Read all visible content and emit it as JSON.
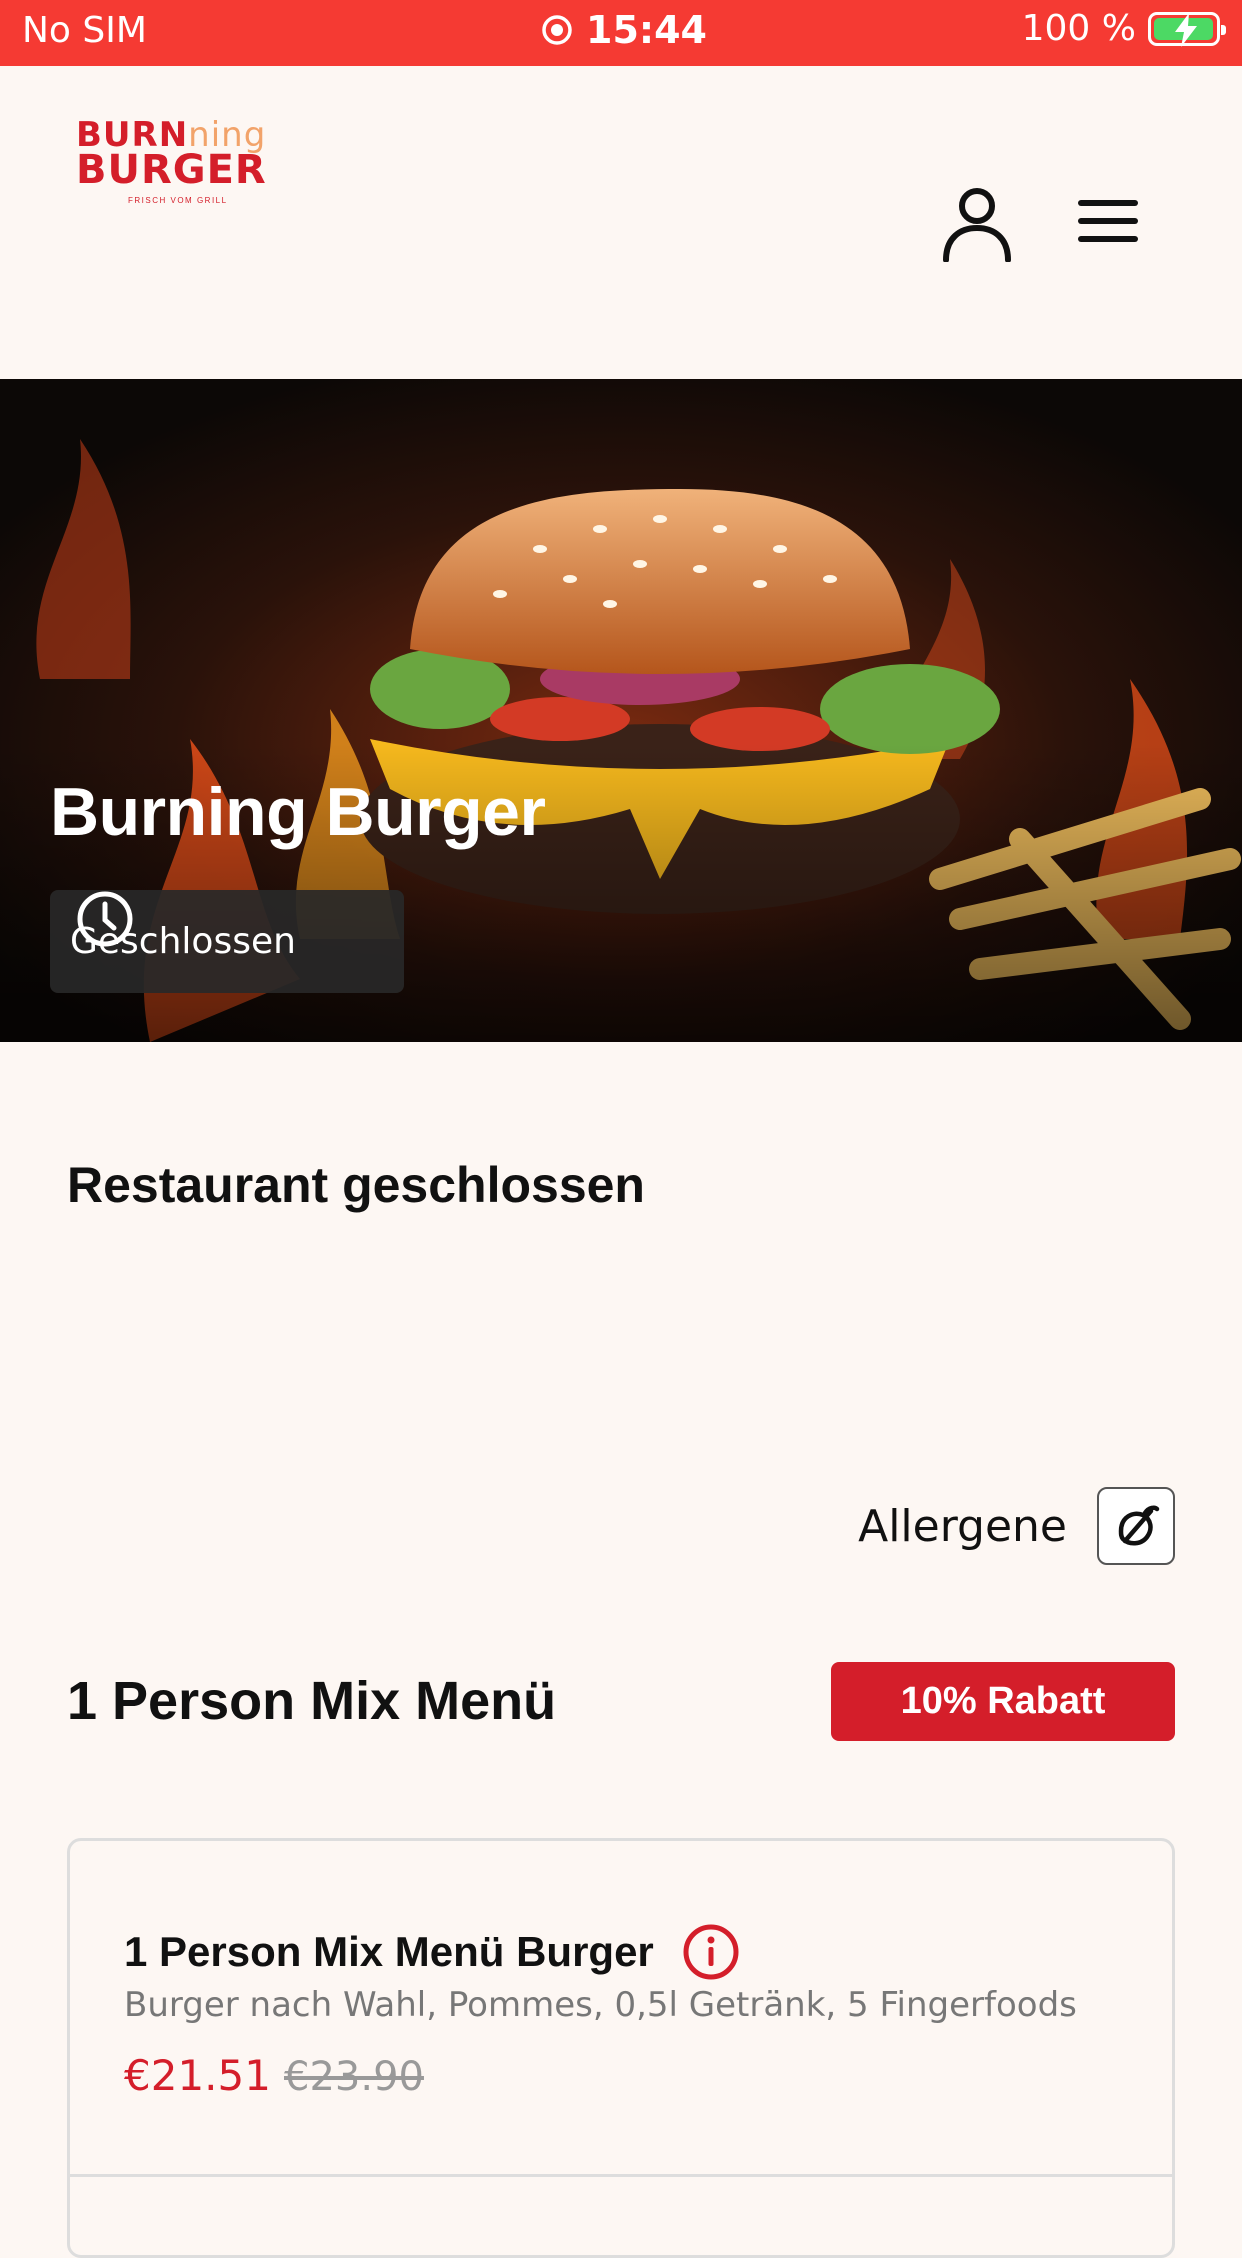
{
  "status_bar": {
    "carrier": "No SIM",
    "time": "15:44",
    "battery": "100 %"
  },
  "header": {
    "logo": {
      "line1_a": "BURN",
      "line1_b": "ning",
      "line2": "BURGER",
      "tagline": "FRISCH VOM GRILL"
    }
  },
  "hero": {
    "title": "Burning Burger",
    "status": "Geschlossen"
  },
  "notice": {
    "title": "Restaurant geschlossen"
  },
  "allergens": {
    "label": "Allergene"
  },
  "section": {
    "title": "1 Person Mix Menü",
    "badge": "10% Rabatt"
  },
  "items": [
    {
      "name": "1 Person Mix Menü Burger",
      "description": "Burger nach Wahl, Pommes, 0,5l Getränk, 5 Fingerfoods",
      "price": "€21.51",
      "old_price": "€23.90"
    }
  ],
  "colors": {
    "accent": "#d41e2a",
    "status_bar": "#f53a33",
    "background": "#fdf7f3"
  }
}
